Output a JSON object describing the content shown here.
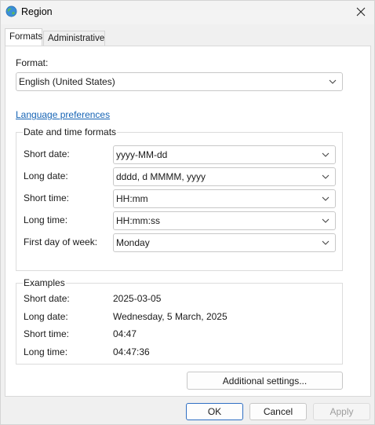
{
  "window": {
    "title": "Region",
    "icon": "globe-icon",
    "close_icon": "close-icon"
  },
  "tabs": [
    {
      "label": "Formats",
      "active": true
    },
    {
      "label": "Administrative",
      "active": false
    }
  ],
  "format": {
    "label": "Format:",
    "value": "English (United States)"
  },
  "language_link": "Language preferences",
  "date_time": {
    "title": "Date and time formats",
    "rows": [
      {
        "label": "Short date:",
        "value": "yyyy-MM-dd"
      },
      {
        "label": "Long date:",
        "value": "dddd, d MMMM, yyyy"
      },
      {
        "label": "Short time:",
        "value": "HH:mm"
      },
      {
        "label": "Long time:",
        "value": "HH:mm:ss"
      },
      {
        "label": "First day of week:",
        "value": "Monday"
      }
    ]
  },
  "examples": {
    "title": "Examples",
    "rows": [
      {
        "label": "Short date:",
        "value": "2025-03-05"
      },
      {
        "label": "Long date:",
        "value": "Wednesday, 5 March, 2025"
      },
      {
        "label": "Short time:",
        "value": "04:47"
      },
      {
        "label": "Long time:",
        "value": "04:47:36"
      }
    ]
  },
  "buttons": {
    "additional": "Additional settings...",
    "ok": "OK",
    "cancel": "Cancel",
    "apply": "Apply"
  },
  "colors": {
    "link": "#1664b5",
    "primary_border": "#2f6fc3"
  }
}
